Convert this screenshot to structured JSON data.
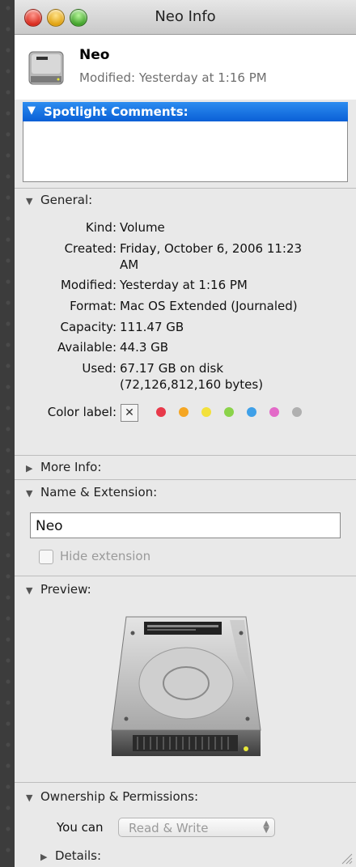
{
  "window": {
    "title": "Neo Info"
  },
  "header": {
    "name": "Neo",
    "modified": "Modified: Yesterday at 1:16 PM"
  },
  "spotlight": {
    "label": "Spotlight Comments:",
    "text": ""
  },
  "general": {
    "label": "General:",
    "rows": [
      {
        "label": "Kind:",
        "value": "Volume"
      },
      {
        "label": "Created:",
        "value": "Friday, October 6, 2006 11:23",
        "value2": "AM"
      },
      {
        "label": "Modified:",
        "value": "Yesterday at 1:16 PM"
      },
      {
        "label": "Format:",
        "value": "Mac OS Extended (Journaled)"
      },
      {
        "label": "Capacity:",
        "value": "111.47 GB"
      },
      {
        "label": "Available:",
        "value": "44.3 GB"
      },
      {
        "label": "Used:",
        "value": "67.17 GB on disk",
        "value2": "(72,126,812,160 bytes)"
      }
    ],
    "color_label": "Color label:",
    "colors": [
      "#e8394a",
      "#f5a623",
      "#f3e13b",
      "#8bd34a",
      "#3fa0e8",
      "#e36ac8",
      "#b0b0b0"
    ]
  },
  "more_info": {
    "label": "More Info:"
  },
  "name_extension": {
    "label": "Name & Extension:",
    "value": "Neo",
    "hide_extension": "Hide extension"
  },
  "preview": {
    "label": "Preview:"
  },
  "ownership": {
    "label": "Ownership & Permissions:",
    "you_can": "You can",
    "permission": "Read & Write",
    "details": "Details:"
  }
}
